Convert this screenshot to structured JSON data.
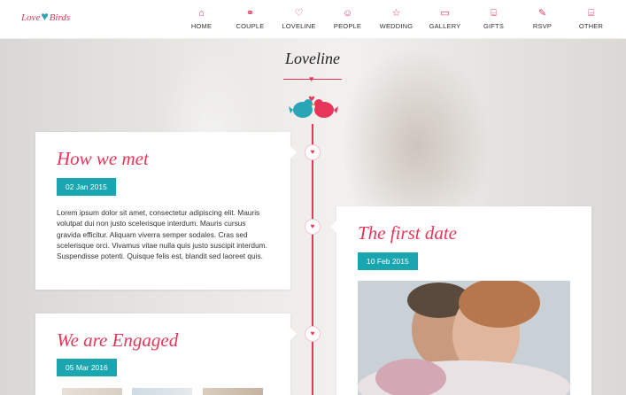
{
  "logo": {
    "left_text": "Love",
    "right_text": "Birds"
  },
  "nav": [
    {
      "label": "HOME",
      "icon": "home-icon",
      "glyph": "⌂"
    },
    {
      "label": "COUPLE",
      "icon": "couple-icon",
      "glyph": "⚭"
    },
    {
      "label": "LOVELINE",
      "icon": "heart-icon",
      "glyph": "♡"
    },
    {
      "label": "PEOPLE",
      "icon": "people-icon",
      "glyph": "☺"
    },
    {
      "label": "WEDDING",
      "icon": "star-icon",
      "glyph": "☆"
    },
    {
      "label": "GALLERY",
      "icon": "gallery-icon",
      "glyph": "▭"
    },
    {
      "label": "GIFTS",
      "icon": "gift-icon",
      "glyph": "⌸"
    },
    {
      "label": "RSVP",
      "icon": "pen-icon",
      "glyph": "✎"
    },
    {
      "label": "OTHER",
      "icon": "other-icon",
      "glyph": "⌸"
    }
  ],
  "timeline": {
    "title": "Loveline",
    "accent": "#e8355a",
    "badge_color": "#19a6b0"
  },
  "events": {
    "how_we_met": {
      "title": "How we met",
      "date": "02 Jan 2015",
      "text": "Lorem ipsum dolor sit amet, consectetur adipiscing elit. Mauris volutpat dui non justo scelerisque interdum. Mauris cursus gravida efficitur. Aliquam viverra semper sodales. Cras sed scelerisque orci. Vivamus vitae nulla quis justo suscipit interdum. Suspendisse potenti. Quisque felis est, blandit sed laoreet quis."
    },
    "first_date": {
      "title": "The first date",
      "date": "10 Feb 2015"
    },
    "engaged": {
      "title": "We are Engaged",
      "date": "05 Mar 2016"
    }
  }
}
